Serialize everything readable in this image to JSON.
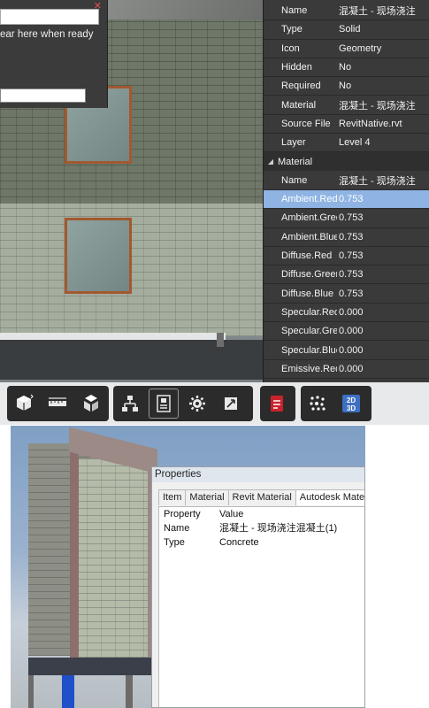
{
  "popup": {
    "hint": "ear here when ready"
  },
  "properties_top": {
    "rows": [
      {
        "key": "Name",
        "value": "混凝土 - 现场浇注"
      },
      {
        "key": "Type",
        "value": "Solid"
      },
      {
        "key": "Icon",
        "value": "Geometry"
      },
      {
        "key": "Hidden",
        "value": "No"
      },
      {
        "key": "Required",
        "value": "No"
      },
      {
        "key": "Material",
        "value": "混凝土 - 现场浇注"
      },
      {
        "key": "Source File",
        "value": "RevitNative.rvt"
      },
      {
        "key": "Layer",
        "value": "Level 4"
      }
    ],
    "group_label": "Material",
    "material_rows": [
      {
        "key": "Name",
        "value": "混凝土 - 现场浇注"
      },
      {
        "key": "Ambient.Red",
        "value": "0.753"
      },
      {
        "key": "Ambient.Green",
        "value": "0.753"
      },
      {
        "key": "Ambient.Blue",
        "value": "0.753"
      },
      {
        "key": "Diffuse.Red",
        "value": "0.753"
      },
      {
        "key": "Diffuse.Green",
        "value": "0.753"
      },
      {
        "key": "Diffuse.Blue",
        "value": "0.753"
      },
      {
        "key": "Specular.Red",
        "value": "0.000"
      },
      {
        "key": "Specular.Green",
        "value": "0.000"
      },
      {
        "key": "Specular.Blue",
        "value": "0.000"
      },
      {
        "key": "Emissive.Red",
        "value": "0.000"
      }
    ],
    "selected_key": "Ambient.Red"
  },
  "toolbar": {
    "icons": [
      "orbit-cube-icon",
      "measure-icon",
      "explode-icon",
      "model-tree-icon",
      "properties-icon",
      "settings-icon",
      "fullscreen-icon",
      "pdf-icon",
      "point-cloud-icon",
      "2d-3d-toggle-icon"
    ],
    "toggle_2d": "2D",
    "toggle_3d": "3D"
  },
  "dialog": {
    "title": "Properties",
    "tabs": [
      "Item",
      "Material",
      "Revit Material",
      "Autodesk Materi"
    ],
    "active_tab": "Autodesk Materi",
    "header": {
      "col1": "Property",
      "col2": "Value"
    },
    "rows": [
      {
        "property": "Name",
        "value": "混凝土 - 现场浇注混凝土(1)"
      },
      {
        "property": "Type",
        "value": "Concrete"
      }
    ]
  },
  "colors": {
    "panel_bg": "#3a3a3a",
    "selection": "#8fb4e3",
    "toolbar_bg": "#2b2b2b",
    "highlight_column": "#1f4fc9"
  }
}
